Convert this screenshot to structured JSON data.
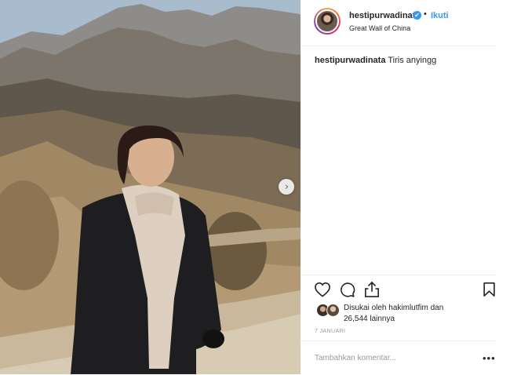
{
  "post": {
    "username": "hestipurwadinata",
    "verified_mark": "✔",
    "separator": "•",
    "follow_label": "Ikuti",
    "location": "Great Wall of China",
    "caption_user": "hestipurwadinata",
    "caption_text": "Tiris anyingg",
    "likes_prefix": "Disukai oleh",
    "likes_user": "hakimlutfim",
    "likes_mid": "dan",
    "likes_count": "26,544 lainnya",
    "date": "7 JANUARI",
    "comment_placeholder": "Tambahkan komentar...",
    "more_label": "•••"
  },
  "icons": {
    "like": "heart-icon",
    "comment": "comment-icon",
    "share": "share-icon",
    "save": "bookmark-icon",
    "next": "chevron-right-icon"
  },
  "colors": {
    "accent": "#3897f0",
    "border": "#efefef",
    "muted": "#999999",
    "text": "#262626"
  }
}
